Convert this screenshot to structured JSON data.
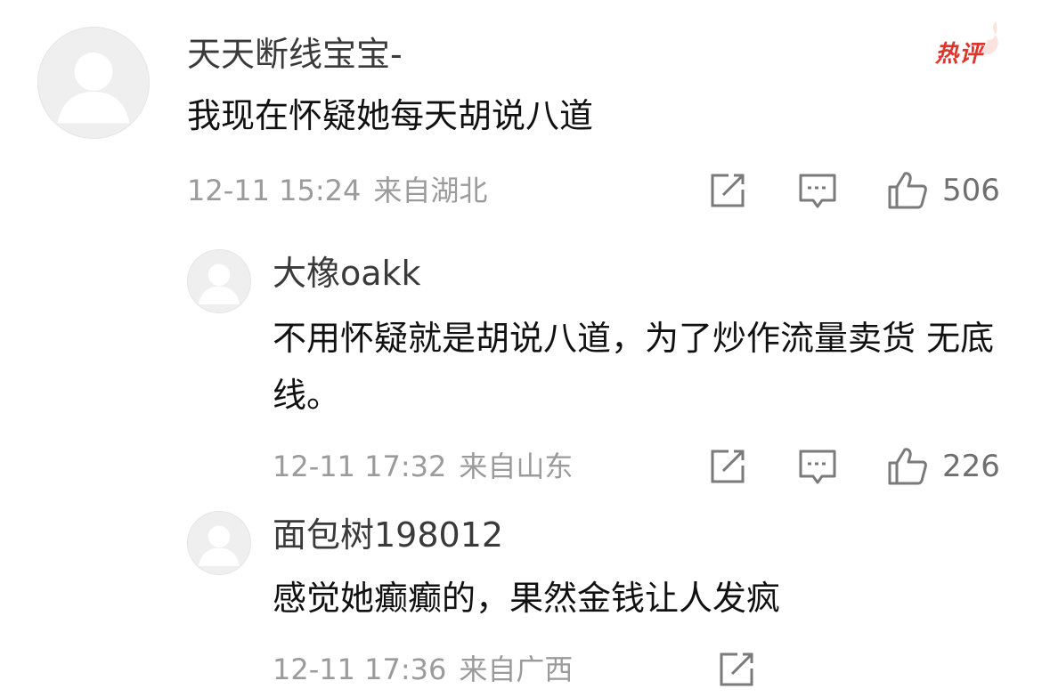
{
  "badge": {
    "hot_label": "热评"
  },
  "comments": [
    {
      "username": "天天断线宝宝-",
      "text": "我现在怀疑她每天胡说八道",
      "time": "12-11 15:24",
      "location": "来自湖北",
      "likes": "506",
      "icons": [
        "share-icon",
        "comment-icon",
        "like-icon"
      ]
    },
    {
      "username": "大橡oakk",
      "text": "不用怀疑就是胡说八道，为了炒作流量卖货 无底线。",
      "time": "12-11 17:32",
      "location": "来自山东",
      "likes": "226",
      "icons": [
        "share-icon",
        "comment-icon",
        "like-icon"
      ]
    },
    {
      "username": "面包树198012",
      "text": "感觉她癫癫的，果然金钱让人发疯",
      "time": "12-11 17:36",
      "location": "来自广西",
      "icons": [
        "share-icon"
      ]
    }
  ],
  "colors": {
    "hot": "#e0342a",
    "meta": "#9b9b9b",
    "icon": "#7a7a7a"
  }
}
